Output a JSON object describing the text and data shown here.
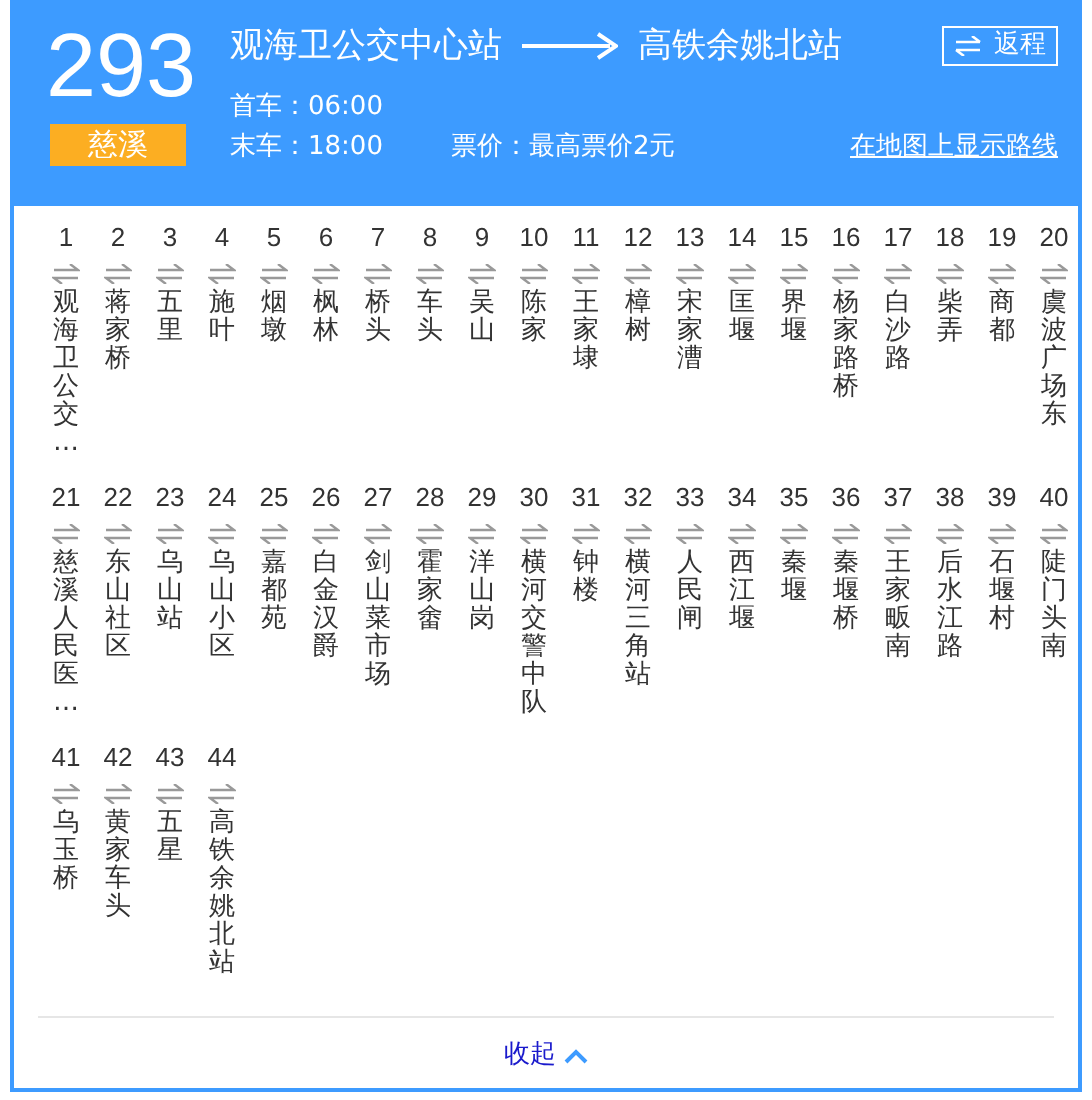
{
  "route": {
    "number": "293",
    "area": "慈溪",
    "from": "观海卫公交中心站",
    "to": "高铁余姚北站",
    "return_button": "返程",
    "first_bus": "首车：06:00",
    "last_bus": "末车：18:00",
    "fare": "票价：最高票价2元",
    "map_link": "在地图上显示路线"
  },
  "stops": [
    {
      "index": "1",
      "name": "观海卫公交…"
    },
    {
      "index": "2",
      "name": "蒋家桥"
    },
    {
      "index": "3",
      "name": "五里"
    },
    {
      "index": "4",
      "name": "施叶"
    },
    {
      "index": "5",
      "name": "烟墩"
    },
    {
      "index": "6",
      "name": "枫林"
    },
    {
      "index": "7",
      "name": "桥头"
    },
    {
      "index": "8",
      "name": "车头"
    },
    {
      "index": "9",
      "name": "吴山"
    },
    {
      "index": "10",
      "name": "陈家"
    },
    {
      "index": "11",
      "name": "王家埭"
    },
    {
      "index": "12",
      "name": "樟树"
    },
    {
      "index": "13",
      "name": "宋家漕"
    },
    {
      "index": "14",
      "name": "匡堰"
    },
    {
      "index": "15",
      "name": "界堰"
    },
    {
      "index": "16",
      "name": "杨家路桥"
    },
    {
      "index": "17",
      "name": "白沙路"
    },
    {
      "index": "18",
      "name": "柴弄"
    },
    {
      "index": "19",
      "name": "商都"
    },
    {
      "index": "20",
      "name": "虞波广场东"
    },
    {
      "index": "21",
      "name": "慈溪人民医…"
    },
    {
      "index": "22",
      "name": "东山社区"
    },
    {
      "index": "23",
      "name": "乌山站"
    },
    {
      "index": "24",
      "name": "乌山小区"
    },
    {
      "index": "25",
      "name": "嘉都苑"
    },
    {
      "index": "26",
      "name": "白金汉爵"
    },
    {
      "index": "27",
      "name": "剑山菜市场"
    },
    {
      "index": "28",
      "name": "霍家畬"
    },
    {
      "index": "29",
      "name": "洋山岗"
    },
    {
      "index": "30",
      "name": "横河交警中队"
    },
    {
      "index": "31",
      "name": "钟楼"
    },
    {
      "index": "32",
      "name": "横河三角站"
    },
    {
      "index": "33",
      "name": "人民闸"
    },
    {
      "index": "34",
      "name": "西江堰"
    },
    {
      "index": "35",
      "name": "秦堰"
    },
    {
      "index": "36",
      "name": "秦堰桥"
    },
    {
      "index": "37",
      "name": "王家畈南"
    },
    {
      "index": "38",
      "name": "后水江路"
    },
    {
      "index": "39",
      "name": "石堰村"
    },
    {
      "index": "40",
      "name": "陡门头南"
    },
    {
      "index": "41",
      "name": "乌玉桥"
    },
    {
      "index": "42",
      "name": "黄家车头"
    },
    {
      "index": "43",
      "name": "五星"
    },
    {
      "index": "44",
      "name": "高铁余姚北站"
    }
  ],
  "collapse_link": "收起"
}
